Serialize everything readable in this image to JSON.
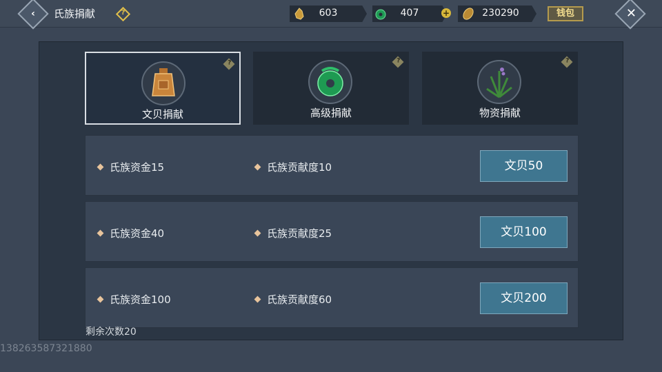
{
  "header": {
    "title": "氏族捐献",
    "help_icon": "question-diamond-icon",
    "wallet_label": "钱包"
  },
  "currencies": [
    {
      "icon": "bell-token-icon",
      "value": "603"
    },
    {
      "icon": "jade-ring-icon",
      "value": "407"
    },
    {
      "icon": "wheat-coin-icon",
      "value": "230290"
    }
  ],
  "tabs": [
    {
      "label": "文贝捐献",
      "icon": "bronze-bell-icon",
      "active": true
    },
    {
      "label": "高级捐献",
      "icon": "jade-ring-icon",
      "active": false
    },
    {
      "label": "物资捐献",
      "icon": "herb-plant-icon",
      "active": false
    }
  ],
  "options": [
    {
      "fund": "氏族资金15",
      "contribution": "氏族贡献度10",
      "button": "文贝50"
    },
    {
      "fund": "氏族资金40",
      "contribution": "氏族贡献度25",
      "button": "文贝100"
    },
    {
      "fund": "氏族资金100",
      "contribution": "氏族贡献度60",
      "button": "文贝200"
    }
  ],
  "remaining": "剩余次数20",
  "watermark": "138263587321880",
  "colors": {
    "background": "#3b4656",
    "panel": "#2b3644",
    "button": "#3f7690",
    "accent_gold": "#e2c04a"
  }
}
